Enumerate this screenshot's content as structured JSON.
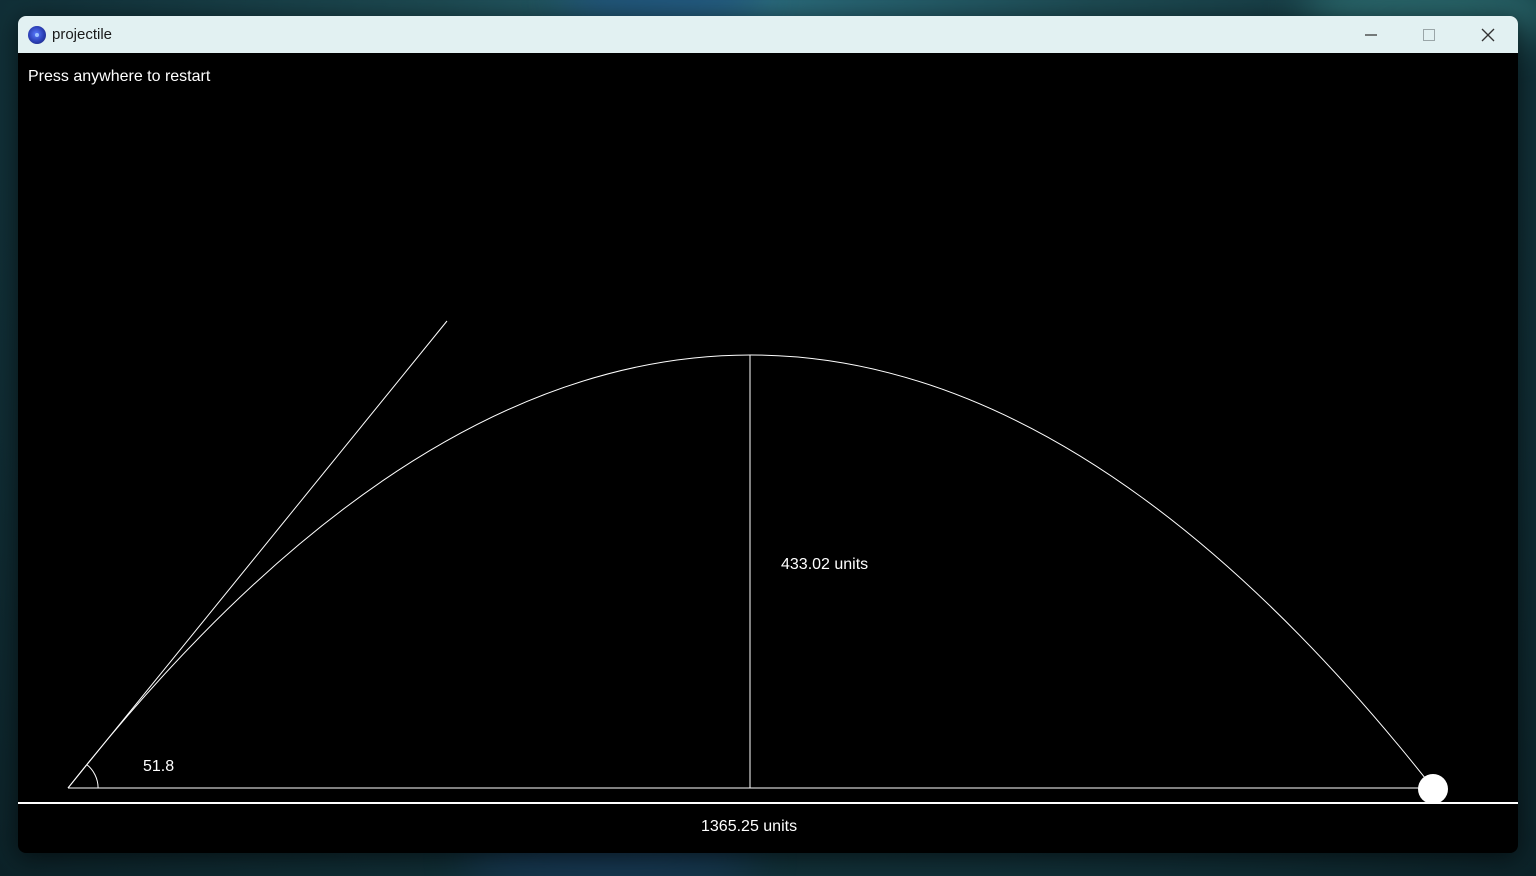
{
  "window": {
    "title": "projectile",
    "icon": "app-icon",
    "controls": [
      "minimize-icon",
      "maximize-icon",
      "close-icon"
    ]
  },
  "hint_text": "Press anywhere to restart",
  "launch_angle_label": "51.8",
  "max_height_label": "433.02 units",
  "range_label": "1365.25 units",
  "colors": {
    "canvas_bg": "#000000",
    "stroke": "#ffffff",
    "titlebar_bg": "#e2f1f2"
  }
}
